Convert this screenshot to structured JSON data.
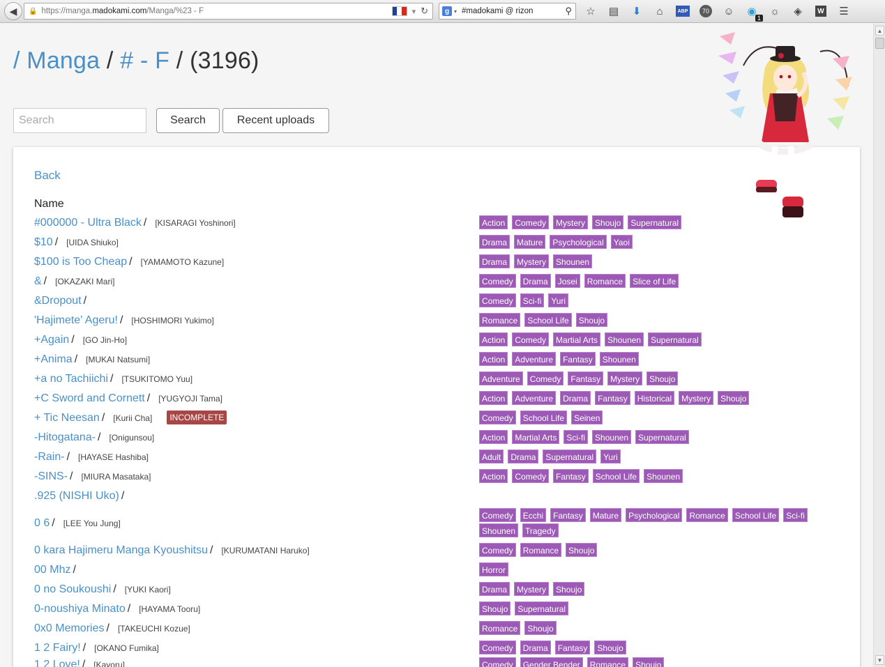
{
  "browser": {
    "url_prefix": "https://manga.",
    "url_host": "madokami.com",
    "url_path": "/Manga/%23 - F",
    "search_engine_text": "#madokami @ rizon",
    "ext_70": "70",
    "ext_badge": "1",
    "ext_w": "W",
    "ext_abp": "ABP"
  },
  "breadcrumb": {
    "root": "/ Manga",
    "sep": "/",
    "current": "# - F",
    "count": "/ (3196)"
  },
  "search": {
    "placeholder": "Search",
    "search_label": "Search",
    "recent_label": "Recent uploads"
  },
  "panel": {
    "back_label": "Back",
    "name_header": "Name"
  },
  "manga": [
    {
      "title": "#000000 - Ultra Black",
      "author": "[KISARAGI Yoshinori]",
      "tags": [
        "Action",
        "Comedy",
        "Mystery",
        "Shoujo",
        "Supernatural"
      ]
    },
    {
      "title": "$10",
      "author": "[UIDA Shiuko]",
      "tags": [
        "Drama",
        "Mature",
        "Psychological",
        "Yaoi"
      ]
    },
    {
      "title": "$100 is Too Cheap",
      "author": "[YAMAMOTO Kazune]",
      "tags": [
        "Drama",
        "Mystery",
        "Shounen"
      ]
    },
    {
      "title": "&",
      "author": "[OKAZAKI Mari]",
      "tags": [
        "Comedy",
        "Drama",
        "Josei",
        "Romance",
        "Slice of Life"
      ]
    },
    {
      "title": "&Dropout",
      "author": "",
      "tags": [
        "Comedy",
        "Sci-fi",
        "Yuri"
      ]
    },
    {
      "title": "'Hajimete' Ageru!",
      "author": "[HOSHIMORI Yukimo]",
      "tags": [
        "Romance",
        "School Life",
        "Shoujo"
      ]
    },
    {
      "title": "+Again",
      "author": "[GO Jin-Ho]",
      "tags": [
        "Action",
        "Comedy",
        "Martial Arts",
        "Shounen",
        "Supernatural"
      ]
    },
    {
      "title": "+Anima",
      "author": "[MUKAI Natsumi]",
      "tags": [
        "Action",
        "Adventure",
        "Fantasy",
        "Shounen"
      ]
    },
    {
      "title": "+a no Tachiichi",
      "author": "[TSUKITOMO Yuu]",
      "tags": [
        "Adventure",
        "Comedy",
        "Fantasy",
        "Mystery",
        "Shoujo"
      ]
    },
    {
      "title": "+C Sword and Cornett",
      "author": "[YUGYOJI Tama]",
      "tags": [
        "Action",
        "Adventure",
        "Drama",
        "Fantasy",
        "Historical",
        "Mystery",
        "Shoujo"
      ]
    },
    {
      "title": "+ Tic Neesan",
      "author": "[Kurii Cha]",
      "status": "INCOMPLETE",
      "tags": [
        "Comedy",
        "School Life",
        "Seinen"
      ]
    },
    {
      "title": "-Hitogatana-",
      "author": "[Onigunsou]",
      "tags": [
        "Action",
        "Martial Arts",
        "Sci-fi",
        "Shounen",
        "Supernatural"
      ]
    },
    {
      "title": "-Rain-",
      "author": "[HAYASE Hashiba]",
      "tags": [
        "Adult",
        "Drama",
        "Supernatural",
        "Yuri"
      ]
    },
    {
      "title": "-SINS-",
      "author": "[MIURA Masataka]",
      "tags": [
        "Action",
        "Comedy",
        "Fantasy",
        "School Life",
        "Shounen"
      ]
    },
    {
      "title": ".925 (NISHI Uko)",
      "author": "",
      "tags": []
    },
    {
      "title": "0 6",
      "author": "[LEE You Jung]",
      "tags": [
        "Comedy",
        "Ecchi",
        "Fantasy",
        "Mature",
        "Psychological",
        "Romance",
        "School Life",
        "Sci-fi",
        "Shounen",
        "Tragedy"
      ]
    },
    {
      "title": "0 kara Hajimeru Manga Kyoushitsu",
      "author": "[KURUMATANI Haruko]",
      "tags": [
        "Comedy",
        "Romance",
        "Shoujo"
      ]
    },
    {
      "title": "00 Mhz",
      "author": "",
      "tags": [
        "Horror"
      ]
    },
    {
      "title": "0 no Soukoushi",
      "author": "[YUKI Kaori]",
      "tags": [
        "Drama",
        "Mystery",
        "Shoujo"
      ]
    },
    {
      "title": "0-noushiya Minato",
      "author": "[HAYAMA Tooru]",
      "tags": [
        "Shoujo",
        "Supernatural"
      ]
    },
    {
      "title": "0x0 Memories",
      "author": "[TAKEUCHI Kozue]",
      "tags": [
        "Romance",
        "Shoujo"
      ]
    },
    {
      "title": "1 2 Fairy!",
      "author": "[OKANO Fumika]",
      "tags": [
        "Comedy",
        "Drama",
        "Fantasy",
        "Shoujo"
      ]
    },
    {
      "title": "1 2 Love!",
      "author": "[Kayoru]",
      "tags": [
        "Comedy",
        "Gender Bender",
        "Romance",
        "Shoujo"
      ]
    }
  ],
  "colors": {
    "link": "#4a90c8",
    "tag_bg": "#9c59b6",
    "incomplete_bg": "#a84646"
  }
}
